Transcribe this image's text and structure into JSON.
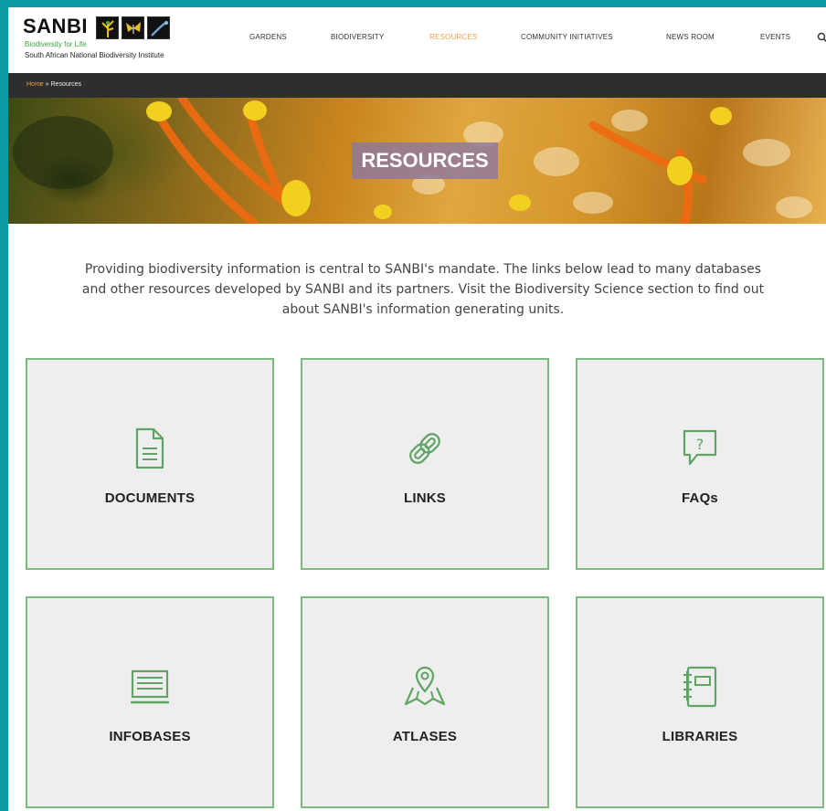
{
  "logo": {
    "name": "SANBI",
    "tagline": "Biodiversity for Life",
    "subtitle": "South African National Biodiversity Institute"
  },
  "nav": {
    "items": [
      {
        "label": "GARDENS"
      },
      {
        "label": "BIODIVERSITY"
      },
      {
        "label": "RESOURCES",
        "active": true
      },
      {
        "label": "COMMUNITY INITIATIVES"
      },
      {
        "label": "NEWS ROOM"
      },
      {
        "label": "EVENTS"
      }
    ],
    "search_icon": "search-icon"
  },
  "breadcrumb": {
    "home": "Home",
    "separator": "»",
    "current": "Resources"
  },
  "hero": {
    "title": "RESOURCES"
  },
  "intro": {
    "text": "Providing biodiversity information is central to SANBI's mandate. The links below lead to many databases and other resources developed by SANBI and its partners. Visit the Biodiversity Science section to find out about SANBI's information generating units."
  },
  "cards": [
    {
      "label": "DOCUMENTS",
      "icon": "document-icon"
    },
    {
      "label": "LINKS",
      "icon": "link-icon"
    },
    {
      "label": "FAQs",
      "icon": "faq-icon"
    },
    {
      "label": "INFOBASES",
      "icon": "infobase-icon"
    },
    {
      "label": "ATLASES",
      "icon": "map-pin-icon"
    },
    {
      "label": "LIBRARIES",
      "icon": "notebook-icon"
    }
  ],
  "colors": {
    "frame": "#0e9aa7",
    "accent_orange": "#f0a24a",
    "card_border": "#7cba7f",
    "icon_green": "#5fa464",
    "card_bg": "#eeeeee",
    "breadcrumb_bg": "#2e2e2e"
  }
}
